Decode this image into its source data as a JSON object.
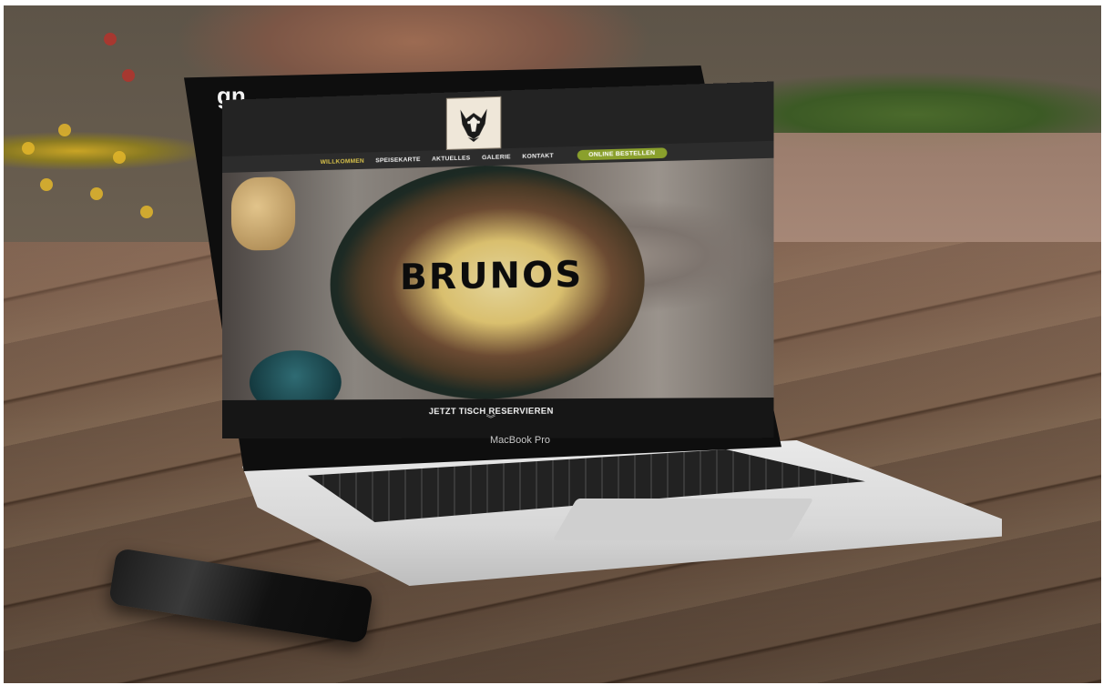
{
  "corner_logo": "gn",
  "laptop_label": "MacBook Pro",
  "website": {
    "nav": {
      "items": [
        "WILLKOMMEN",
        "SPEISEKARTE",
        "AKTUELLES",
        "GALERIE",
        "KONTAKT"
      ],
      "cta": "ONLINE BESTELLEN"
    },
    "hero_title": "BRUNOS",
    "reserve_label": "JETZT TISCH RESERVIEREN",
    "reserve_chevron": "︾",
    "colors": {
      "accent": "#d9c34b",
      "cta": "#8aa02c",
      "header": "#232323"
    }
  }
}
